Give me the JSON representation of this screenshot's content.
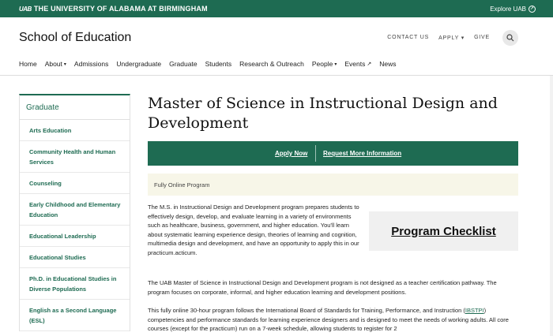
{
  "topbar": {
    "logo": "UAB",
    "university": "THE UNIVERSITY OF ALABAMA AT BIRMINGHAM",
    "explore": "Explore UAB",
    "bg_color": "#1e6b52"
  },
  "header": {
    "site_title": "School of Education",
    "utility": [
      "CONTACT US",
      "APPLY ▾",
      "GIVE"
    ],
    "search_icon": "search-icon"
  },
  "nav": {
    "items": [
      {
        "label": "Home"
      },
      {
        "label": "About",
        "caret": "▾"
      },
      {
        "label": "Admissions"
      },
      {
        "label": "Undergraduate"
      },
      {
        "label": "Graduate"
      },
      {
        "label": "Students"
      },
      {
        "label": "Research & Outreach"
      },
      {
        "label": "People",
        "caret": "▾"
      },
      {
        "label": "Events",
        "ext": "↗"
      },
      {
        "label": "News"
      }
    ]
  },
  "sidebar": {
    "heading": "Graduate",
    "items": [
      {
        "label": "Arts Education",
        "size": "h1"
      },
      {
        "label": "Community Health and Human Services",
        "size": "h2"
      },
      {
        "label": "Counseling",
        "size": "h1"
      },
      {
        "label": "Early Childhood and Elementary Education",
        "size": "h2"
      },
      {
        "label": "Educational Leadership",
        "size": "h1"
      },
      {
        "label": "Educational Studies",
        "size": "h1"
      },
      {
        "label": "Ph.D. in Educational Studies in Diverse Populations",
        "size": "h2"
      },
      {
        "label": "English as a Second Language (ESL)",
        "size": "h2"
      }
    ]
  },
  "main": {
    "title": "Master of Science in Instructional Design and Development",
    "cta": {
      "apply": "Apply Now",
      "request": "Request More Information"
    },
    "program_type": "Fully Online Program",
    "intro": "The M.S. in Instructional Design and Development program prepares students to effectively design, develop, and evaluate learning in a variety of environments such as healthcare, business, government, and higher education. You'll learn about systematic learning experience design, theories of learning and cognition, multimedia design and development, and have an opportunity to apply this in our practicum.acticum.",
    "checklist": "Program Checklist",
    "para2": "The UAB Master of Science in Instructional Design and Development program is not designed as a teacher certification pathway. The program focuses on corporate, informal, and higher education learning and development positions.",
    "para3_a": "This fully online 30-hour program follows the International Board of Standards for Training, Performance, and Instruction (",
    "para3_link": "IBSTPI",
    "para3_b": ") competencies and performance standards for learning experience designers and is designed to meet the needs of working adults. All core courses (except for the practicum) run on a 7-week schedule, allowing students to register for 2"
  }
}
